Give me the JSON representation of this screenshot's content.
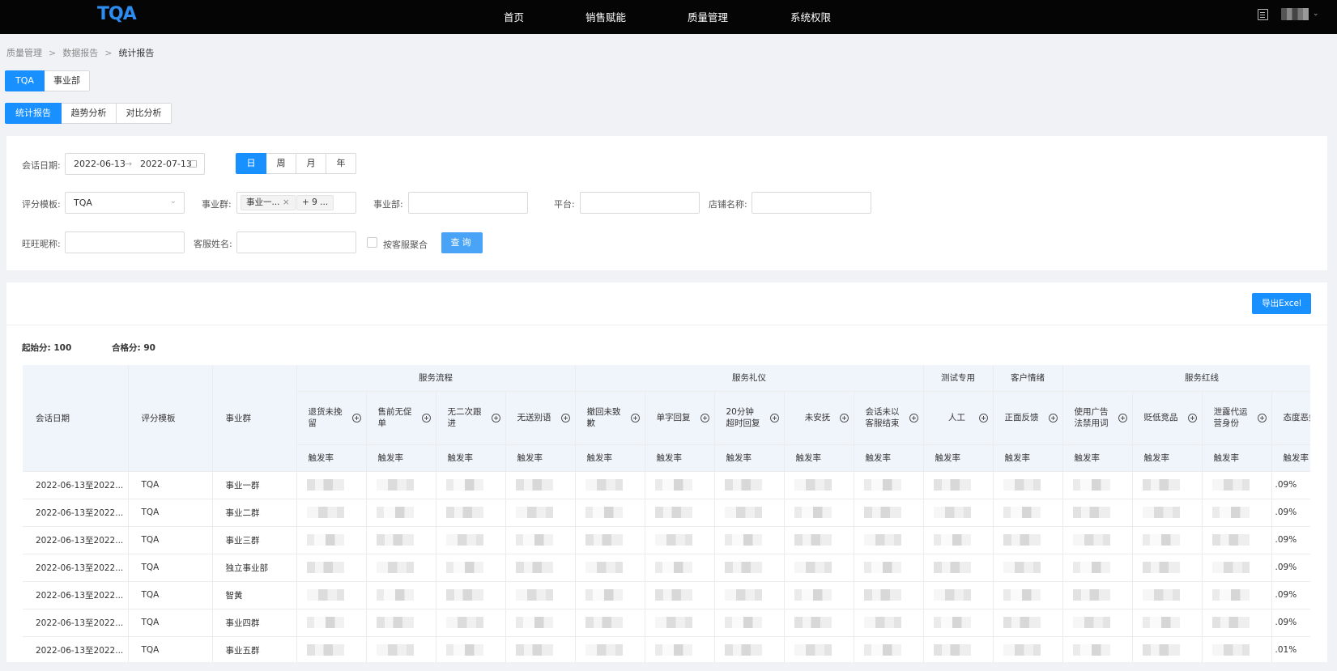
{
  "app": {
    "logo": "TQA"
  },
  "nav": {
    "items": [
      "首页",
      "销售赋能",
      "质量管理",
      "系统权限"
    ]
  },
  "breadcrumb": {
    "items": [
      "质量管理",
      "数据报告",
      "统计报告"
    ],
    "separator": ">"
  },
  "scope_tabs": {
    "items": [
      "TQA",
      "事业部"
    ],
    "active": 0
  },
  "report_tabs": {
    "items": [
      "统计报告",
      "趋势分析",
      "对比分析"
    ],
    "active": 0
  },
  "filters": {
    "date_label": "会话日期:",
    "date_start": "2022-06-13",
    "date_arrow": "→",
    "date_end": "2022-07-13",
    "period": {
      "items": [
        "日",
        "周",
        "月",
        "年"
      ],
      "active": 0
    },
    "template_label": "评分模板:",
    "template_value": "TQA",
    "group_label": "事业群:",
    "group_tag": "事业一...",
    "group_tag_close": "×",
    "group_more": "+ 9 ...",
    "dept_label": "事业部:",
    "platform_label": "平台:",
    "shop_label": "店铺名称:",
    "wangwang_label": "旺旺昵称:",
    "agent_label": "客服姓名:",
    "aggregate_label": "按客服聚合",
    "query_label": "查询"
  },
  "toolbar": {
    "export_label": "导出Excel"
  },
  "scores": {
    "start_label": "起始分:",
    "start_value": "100",
    "pass_label": "合格分:",
    "pass_value": "90"
  },
  "table": {
    "fixed_headers": [
      "会话日期",
      "评分模板",
      "事业群"
    ],
    "groups": [
      {
        "name": "服务流程",
        "span": 4
      },
      {
        "name": "服务礼仪",
        "span": 5
      },
      {
        "name": "测试专用",
        "span": 1
      },
      {
        "name": "客户情绪",
        "span": 1
      },
      {
        "name": "服务红线",
        "span": 4
      }
    ],
    "metrics": [
      "退货未挽留",
      "售前无促单",
      "无二次跟进",
      "无送别语",
      "撤回未致歉",
      "单字回复",
      "20分钟超时回复",
      "未安抚",
      "会话未以客服结束",
      "人工",
      "正面反馈",
      "使用广告法禁用词",
      "贬低竞品",
      "泄露代运营身份",
      "态度恶劣"
    ],
    "sub_label": "触发率",
    "rows": [
      {
        "date": "2022-06-13至2022...",
        "template": "TQA",
        "group": "事业一群",
        "last": ".09%"
      },
      {
        "date": "2022-06-13至2022...",
        "template": "TQA",
        "group": "事业二群",
        "last": ".09%"
      },
      {
        "date": "2022-06-13至2022...",
        "template": "TQA",
        "group": "事业三群",
        "last": ".09%"
      },
      {
        "date": "2022-06-13至2022...",
        "template": "TQA",
        "group": "独立事业部",
        "last": ".09%"
      },
      {
        "date": "2022-06-13至2022...",
        "template": "TQA",
        "group": "智黄",
        "last": ".09%"
      },
      {
        "date": "2022-06-13至2022...",
        "template": "TQA",
        "group": "事业四群",
        "last": ".09%"
      },
      {
        "date": "2022-06-13至2022...",
        "template": "TQA",
        "group": "事业五群",
        "last": ".01%"
      }
    ]
  },
  "colors": {
    "accent": "#1890ff",
    "nav_bg": "#050505",
    "header_bg": "#f0f5fc"
  }
}
